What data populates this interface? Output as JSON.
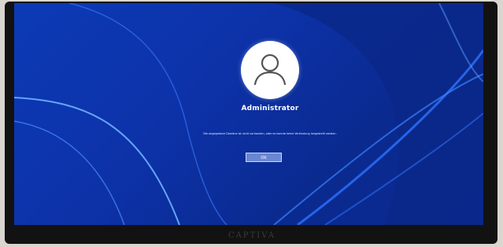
{
  "login": {
    "username": "Administrator",
    "message": "Die angegebene Domäne ist nicht vorhanden, oder es konnte keine Verbindung hergestellt werden.",
    "ok_label": "OK",
    "avatar_icon": "user-icon"
  },
  "device": {
    "brand": "CAPTIVA"
  },
  "colors": {
    "accent": "#0c3ab6",
    "button": "#6b86d1"
  }
}
